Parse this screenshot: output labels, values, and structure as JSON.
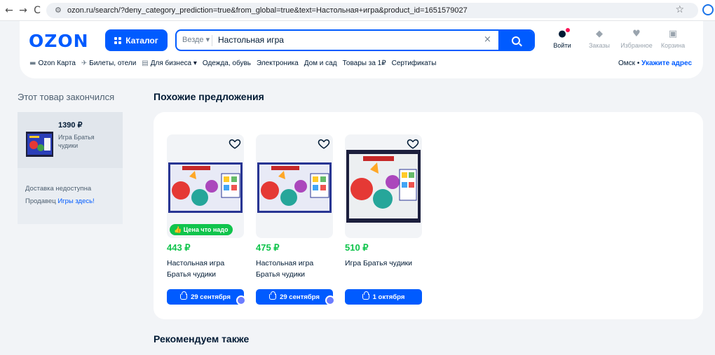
{
  "browser": {
    "back": "←",
    "forward": "→",
    "reload": "C",
    "url": "ozon.ru/search/?deny_category_prediction=true&from_global=true&text=Настольная+игра&product_id=1651579027"
  },
  "header": {
    "logo": "OZON",
    "catalog_label": "Каталог",
    "search_scope": "Везде",
    "search_value": "Настольная игра",
    "clear": "×",
    "actions": [
      {
        "label": "Войти",
        "icon": "user-icon"
      },
      {
        "label": "Заказы",
        "icon": "box-icon"
      },
      {
        "label": "Избранное",
        "icon": "heart-icon"
      },
      {
        "label": "Корзина",
        "icon": "cart-icon"
      }
    ],
    "subnav": [
      {
        "label": "Ozon Карта",
        "icon": "card-icon"
      },
      {
        "label": "Билеты, отели",
        "icon": "plane-icon"
      },
      {
        "label": "Для бизнеса",
        "icon": "briefcase-icon"
      },
      {
        "label": "Одежда, обувь"
      },
      {
        "label": "Электроника"
      },
      {
        "label": "Дом и сад"
      },
      {
        "label": "Товары за 1₽"
      },
      {
        "label": "Сертификаты"
      }
    ],
    "city": "Омск",
    "address_link": "Укажите адрес"
  },
  "sold_out": {
    "title": "Этот товар закончился",
    "price": "1390 ₽",
    "name": "Игра Братья чудики",
    "status": "Доставка недоступна",
    "seller_prefix": "Продавец",
    "seller_name": "Игры здесь!"
  },
  "similar": {
    "title": "Похожие предложения",
    "products": [
      {
        "price": "443 ₽",
        "name": "Настольная игра Братья чудики",
        "badge": "Цена что надо",
        "delivery": "29 сентября",
        "seller_badge": true
      },
      {
        "price": "475 ₽",
        "name": "Настольная игра Братья чудики",
        "badge": "",
        "delivery": "29 сентября",
        "seller_badge": true
      },
      {
        "price": "510 ₽",
        "name": "Игра Братья чудики",
        "badge": "",
        "delivery": "1 октября",
        "seller_badge": false
      }
    ]
  },
  "recommend_title": "Рекомендуем также",
  "colors": {
    "brand": "#005bff",
    "price_green": "#10c44c",
    "badge_green": "#10c44c"
  }
}
